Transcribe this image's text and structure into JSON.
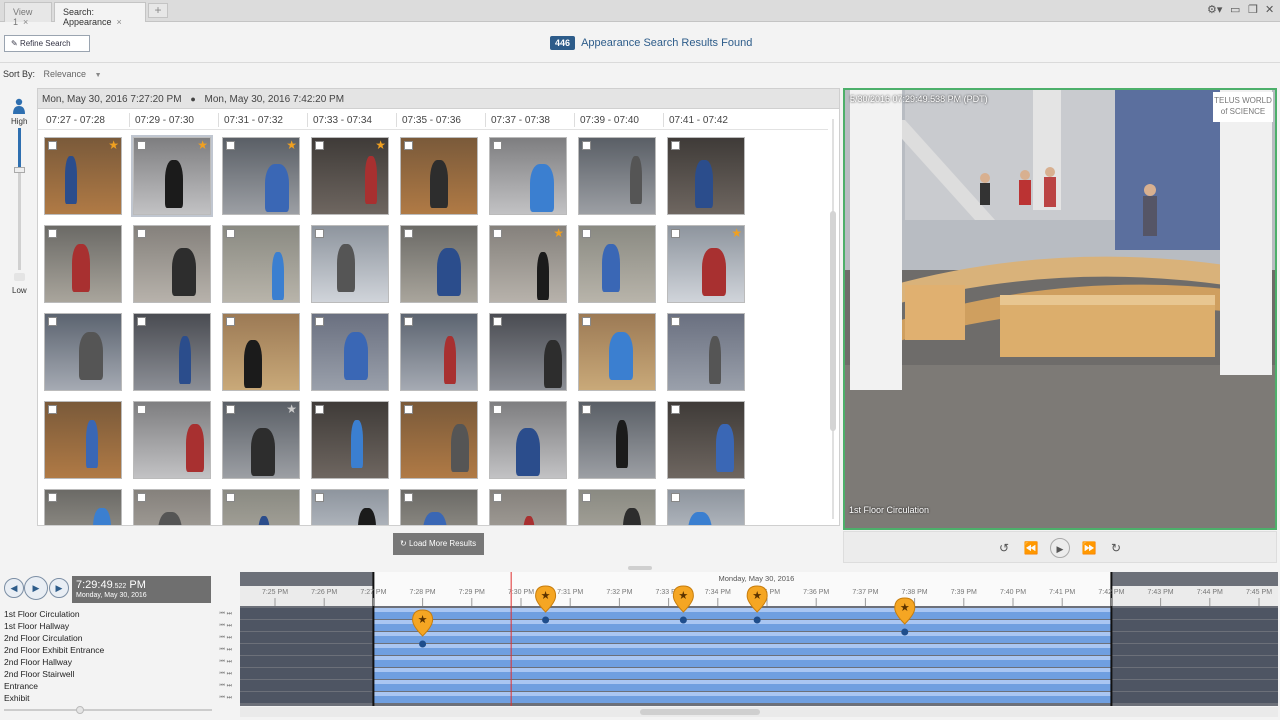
{
  "tabs": [
    {
      "label": "View 1"
    },
    {
      "label": "Search: Appearance"
    }
  ],
  "tab_close": "×",
  "tab_add": "+",
  "window": {
    "gear": "⚙▾",
    "minimize": "▭",
    "restore": "❐",
    "close": "✕"
  },
  "header": {
    "refine_label": "Refine Search",
    "results_count": "446",
    "results_text": "Appearance Search Results Found"
  },
  "sort": {
    "label": "Sort By:",
    "value": "Relevance",
    "arrow": "▼"
  },
  "similarity": {
    "high": "High",
    "low": "Low"
  },
  "range": {
    "start": "Mon, May 30, 2016 7:27:20 PM",
    "end": "Mon, May 30, 2016 7:42:20 PM",
    "clock_icon": "●"
  },
  "buckets": [
    "07:27 - 07:28",
    "07:29 - 07:30",
    "07:31 - 07:32",
    "07:33 - 07:34",
    "07:35 - 07:36",
    "07:37 - 07:38",
    "07:39 - 07:40",
    "07:41 - 07:42"
  ],
  "thumb_stars": [
    [
      true,
      true,
      true,
      true,
      false,
      false,
      false,
      false
    ],
    [
      false,
      false,
      false,
      false,
      false,
      true,
      false,
      true
    ],
    [
      false,
      false,
      false,
      false,
      false,
      false,
      false,
      false
    ],
    [
      false,
      false,
      "off",
      false,
      false,
      false,
      false,
      false
    ],
    [
      false,
      false,
      false,
      false,
      false,
      false,
      false,
      false
    ]
  ],
  "load_more_label": "Load More Results",
  "load_more_icon": "↻",
  "video": {
    "timestamp": "5/30/2016 07:29:49.538 PM (PDT)",
    "camera": "1st Floor Circulation",
    "logo": "TELUS WORLD of SCIENCE"
  },
  "video_controls": {
    "rewind": "↺",
    "prev": "⏪",
    "play": "▶",
    "next": "⏩",
    "forward": "↻"
  },
  "playback": {
    "prev": "◀",
    "play": "▶",
    "next": "▶",
    "time": "7:29:49",
    "ms": ".522",
    "ampm": "PM",
    "date": "Monday, May 30, 2016"
  },
  "timeline": {
    "date_label": "Monday, May 30, 2016",
    "ticks": [
      "7:25 PM",
      "7:26 PM",
      "7:27 PM",
      "7:28 PM",
      "7:29 PM",
      "7:30 PM",
      "7:31 PM",
      "7:32 PM",
      "7:33 PM",
      "7:34 PM",
      "7:35 PM",
      "7:36 PM",
      "7:37 PM",
      "7:38 PM",
      "7:39 PM",
      "7:40 PM",
      "7:41 PM",
      "7:42 PM",
      "7:43 PM",
      "7:44 PM",
      "7:45 PM"
    ],
    "cameras": [
      "1st Floor Circulation",
      "1st Floor Hallway",
      "2nd Floor Circulation",
      "2nd Floor Exhibit Entrance",
      "2nd Floor Hallway",
      "2nd Floor Stairwell",
      "Entrance",
      "Exhibit"
    ],
    "bookmarks": [
      {
        "time_min": 4.0,
        "row": 3
      },
      {
        "time_min": 6.5,
        "row": 1
      },
      {
        "time_min": 9.3,
        "row": 1
      },
      {
        "time_min": 10.8,
        "row": 1
      },
      {
        "time_min": 13.8,
        "row": 2
      }
    ],
    "window_start_min": 3.0,
    "window_end_min": 18.0,
    "cursor_min": 5.8
  },
  "colors": {
    "accent": "#2d5c8a",
    "timeline_blue": "#6f9fe0",
    "bookmark": "#f5a623",
    "video_border": "#4caf6a"
  }
}
